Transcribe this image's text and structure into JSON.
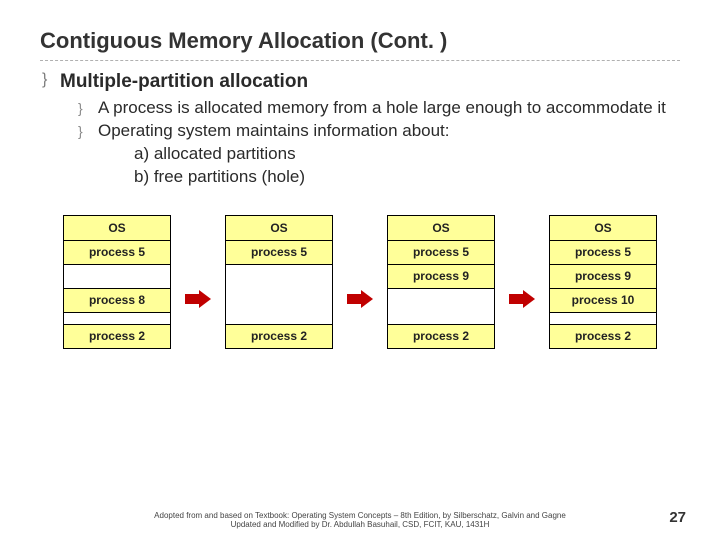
{
  "title": "Contiguous Memory Allocation (Cont. )",
  "heading": "Multiple-partition allocation",
  "bullets": {
    "b1": "A process is allocated memory from a hole large enough to accommodate it",
    "b2": "Operating system maintains information about:",
    "b2a": "a) allocated partitions",
    "b2b": "b) free partitions (hole)"
  },
  "labels": {
    "os": "OS",
    "p5": "process 5",
    "p8": "process 8",
    "p9": "process 9",
    "p10": "process 10",
    "p2": "process 2"
  },
  "footer": {
    "l1": "Adopted from and based on Textbook: Operating System Concepts – 8th Edition, by Silberschatz, Galvin and Gagne",
    "l2": "Updated and Modified by Dr. Abdullah Basuhail, CSD, FCIT, KAU, 1431H"
  },
  "page": "27"
}
